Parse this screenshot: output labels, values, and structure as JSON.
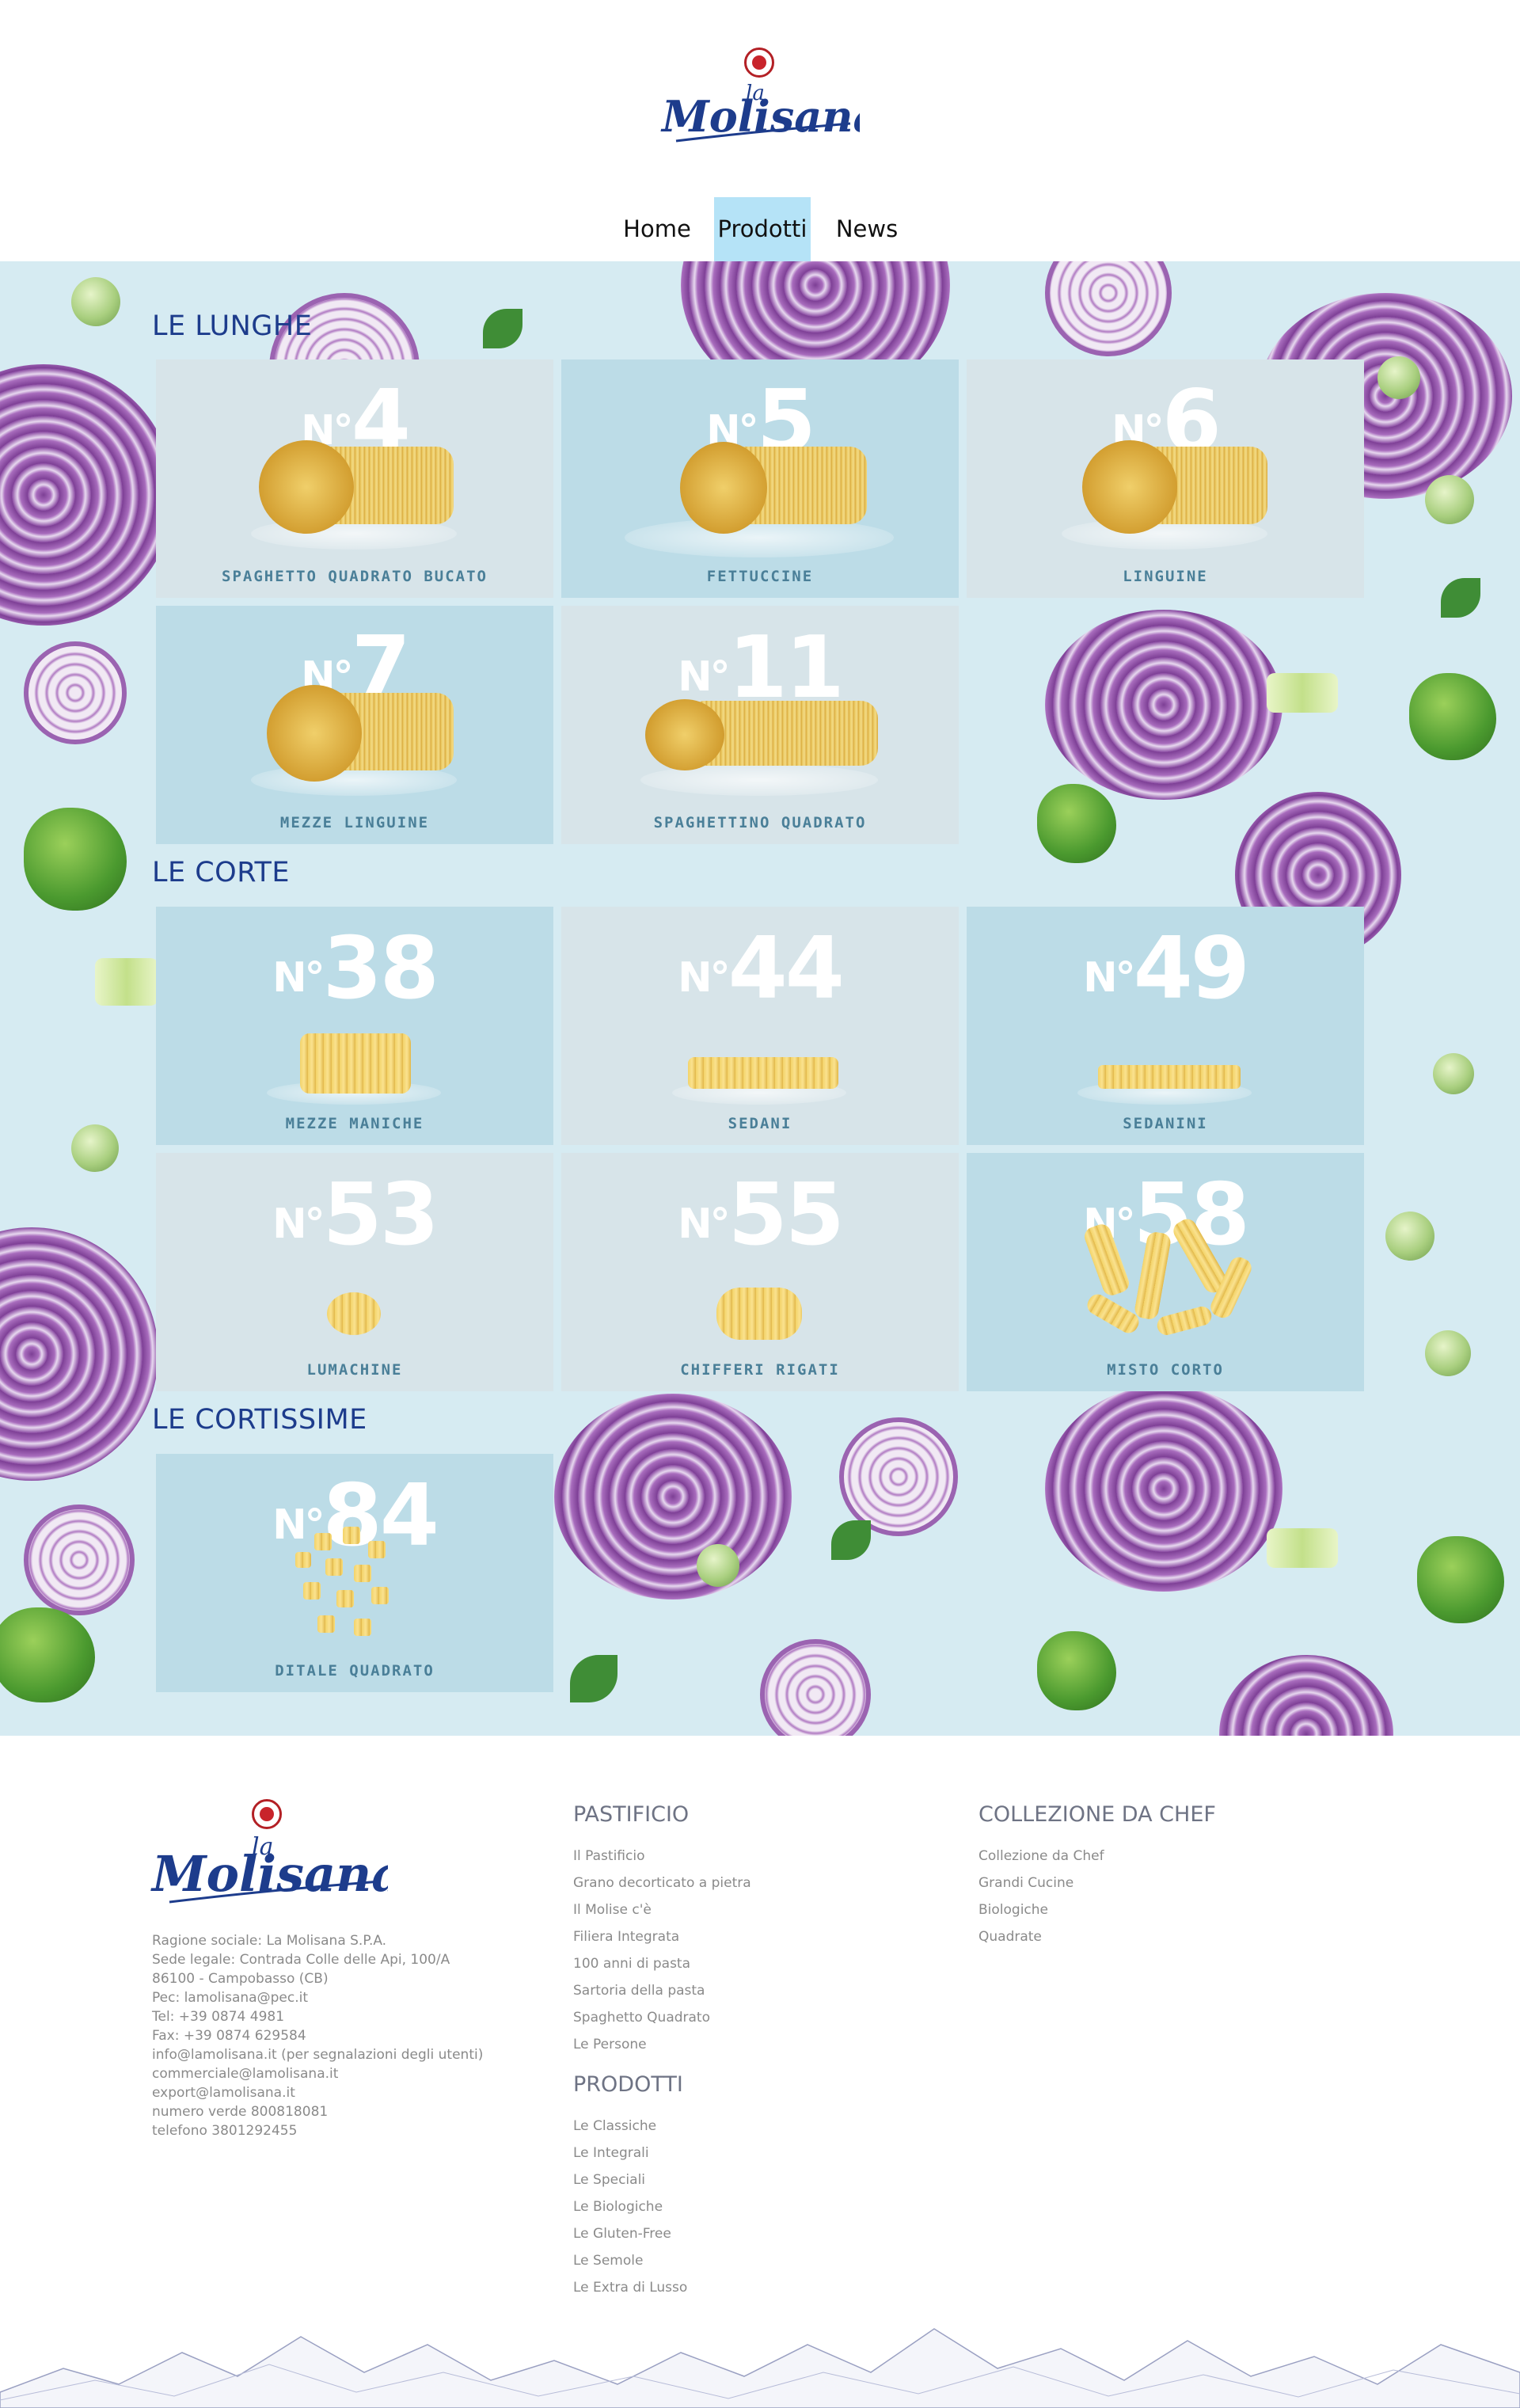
{
  "brand": {
    "logo_top": "la",
    "logo_main": "Molisana"
  },
  "nav": [
    {
      "label": "Home",
      "active": false
    },
    {
      "label": "Prodotti",
      "active": true
    },
    {
      "label": "News",
      "active": false
    }
  ],
  "sections": {
    "lunghe": "LE LUNGHE",
    "corte": "LE CORTE",
    "cortissime": "LE CORTISSIME"
  },
  "products": {
    "p4": {
      "prefix": "N°",
      "number": "4",
      "name": "SPAGHETTO QUADRATO BUCATO"
    },
    "p5": {
      "prefix": "N°",
      "number": "5",
      "name": "FETTUCCINE"
    },
    "p6": {
      "prefix": "N°",
      "number": "6",
      "name": "LINGUINE"
    },
    "p7": {
      "prefix": "N°",
      "number": "7",
      "name": "MEZZE LINGUINE"
    },
    "p11": {
      "prefix": "N°",
      "number": "11",
      "name": "SPAGHETTINO QUADRATO"
    },
    "p38": {
      "prefix": "N°",
      "number": "38",
      "name": "MEZZE MANICHE"
    },
    "p44": {
      "prefix": "N°",
      "number": "44",
      "name": "SEDANI"
    },
    "p49": {
      "prefix": "N°",
      "number": "49",
      "name": "SEDANINI"
    },
    "p53": {
      "prefix": "N°",
      "number": "53",
      "name": "LUMACHINE"
    },
    "p55": {
      "prefix": "N°",
      "number": "55",
      "name": "CHIFFERI RIGATI"
    },
    "p58": {
      "prefix": "N°",
      "number": "58",
      "name": "MISTO CORTO"
    },
    "p84": {
      "prefix": "N°",
      "number": "84",
      "name": "DITALE QUADRATO"
    }
  },
  "footer": {
    "info": [
      "Ragione sociale: La Molisana S.P.A.",
      "Sede legale: Contrada Colle delle Api, 100/A",
      "86100 - Campobasso (CB)",
      "Pec: lamolisana@pec.it",
      "Tel: +39 0874 4981",
      "Fax: +39 0874 629584",
      "info@lamolisana.it (per segnalazioni degli utenti)",
      "commerciale@lamolisana.it",
      "export@lamolisana.it",
      "numero verde 800818081",
      "telefono 3801292455"
    ],
    "pastificio": {
      "title": "PASTIFICIO",
      "links": [
        "Il Pastificio",
        "Grano decorticato a pietra",
        "Il Molise c'è",
        "Filiera Integrata",
        "100 anni di pasta",
        "Sartoria della pasta",
        "Spaghetto Quadrato",
        "Le Persone"
      ]
    },
    "prodotti": {
      "title": "PRODOTTI",
      "links": [
        "Le Classiche",
        "Le Integrali",
        "Le Speciali",
        "Le Biologiche",
        "Le Gluten-Free",
        "Le Semole",
        "Le Extra di Lusso"
      ]
    },
    "chef": {
      "title": "COLLEZIONE DA CHEF",
      "links": [
        "Collezione da Chef",
        "Grandi Cucine",
        "Biologiche",
        "Quadrate"
      ]
    }
  },
  "colors": {
    "accent": "#1d3c8c",
    "nav_active": "#b5e3f7",
    "background": "#d6ebf2"
  }
}
